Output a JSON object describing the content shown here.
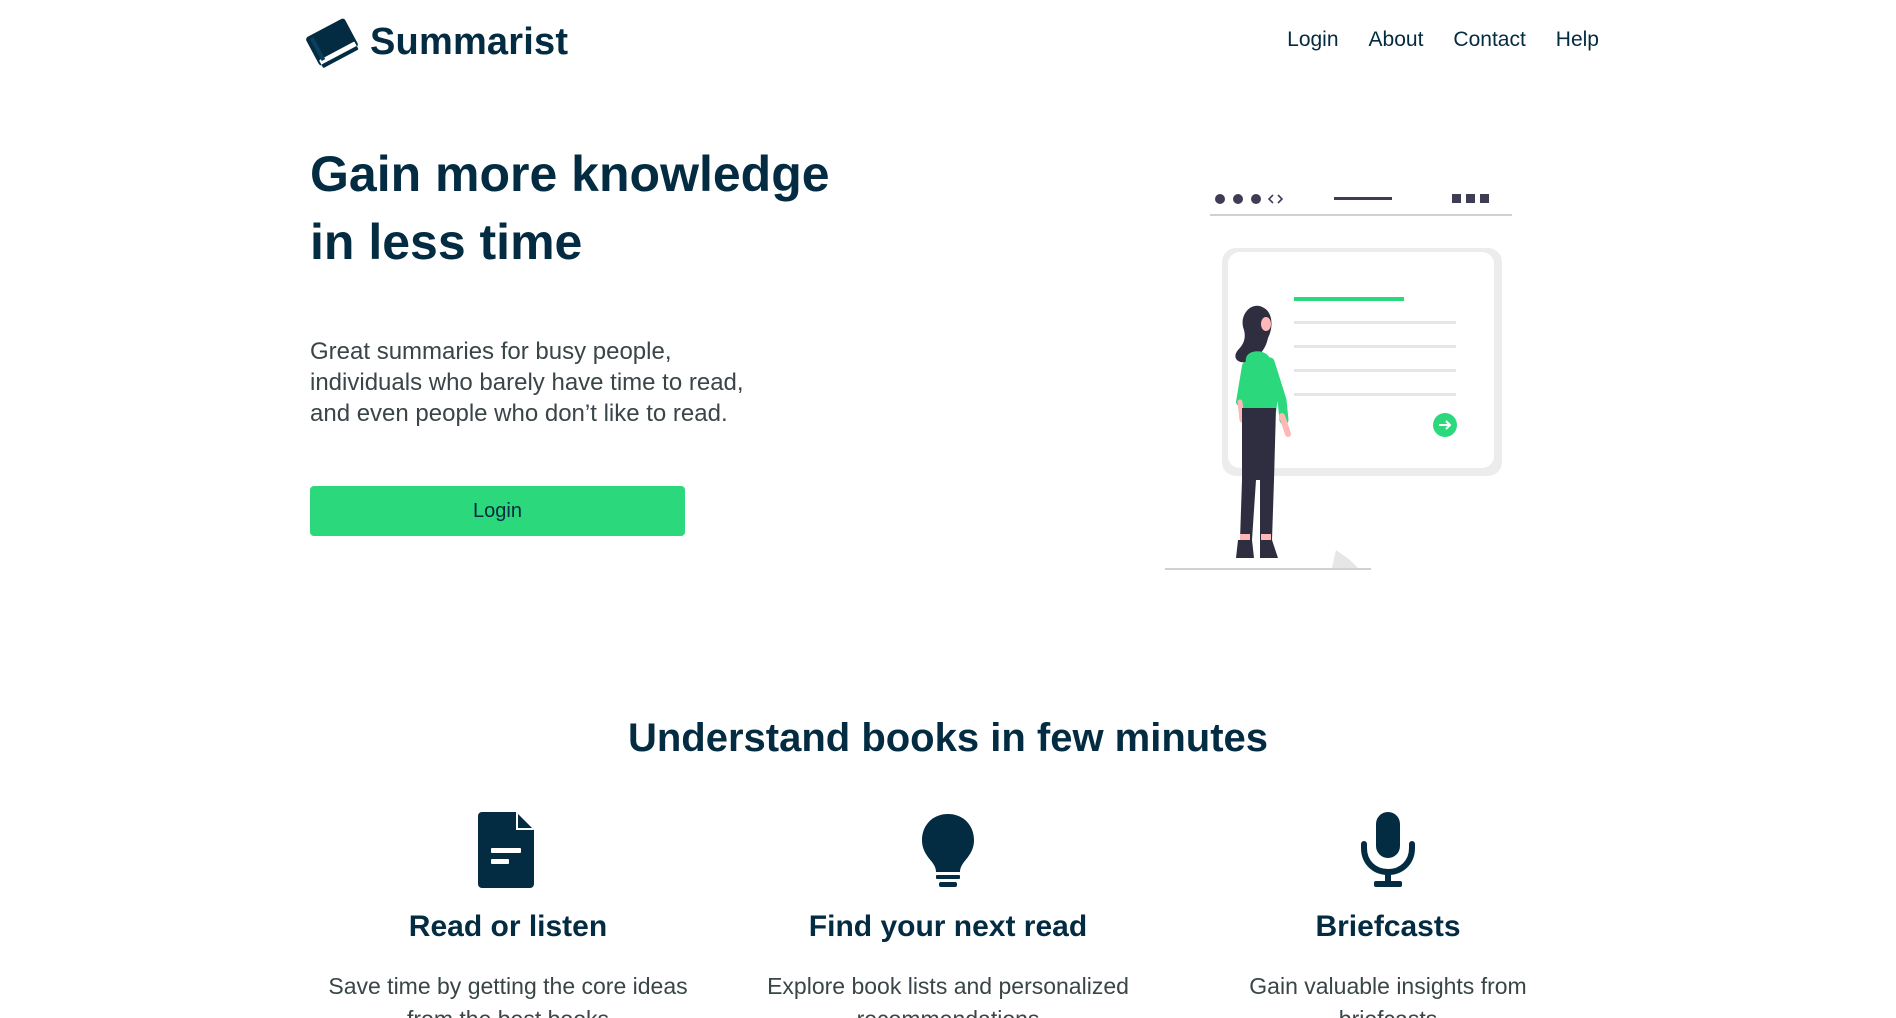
{
  "brand": {
    "name": "Summarist",
    "icon": "book-icon"
  },
  "nav": {
    "links": [
      "Login",
      "About",
      "Contact",
      "Help"
    ]
  },
  "hero": {
    "title_line1": "Gain more knowledge",
    "title_line2": "in less time",
    "subtitle_line1": "Great summaries for busy people,",
    "subtitle_line2": "individuals who barely have time to read,",
    "subtitle_line3": "and even people who don’t like to read.",
    "button_label": "Login",
    "illustration": "woman-reading-screen-illustration"
  },
  "features": {
    "title": "Understand books in few minutes",
    "items": [
      {
        "icon": "document-icon",
        "title": "Read or listen",
        "description": "Save time by getting the core ideas from the best books"
      },
      {
        "icon": "lightbulb-icon",
        "title": "Find your next read",
        "description": "Explore book lists and personalized recommendations"
      },
      {
        "icon": "microphone-icon",
        "title": "Briefcasts",
        "description": "Gain valuable insights from briefcasts"
      }
    ]
  },
  "colors": {
    "primary": "#032b41",
    "accent": "#2bd97c",
    "text_secondary": "#394547"
  }
}
